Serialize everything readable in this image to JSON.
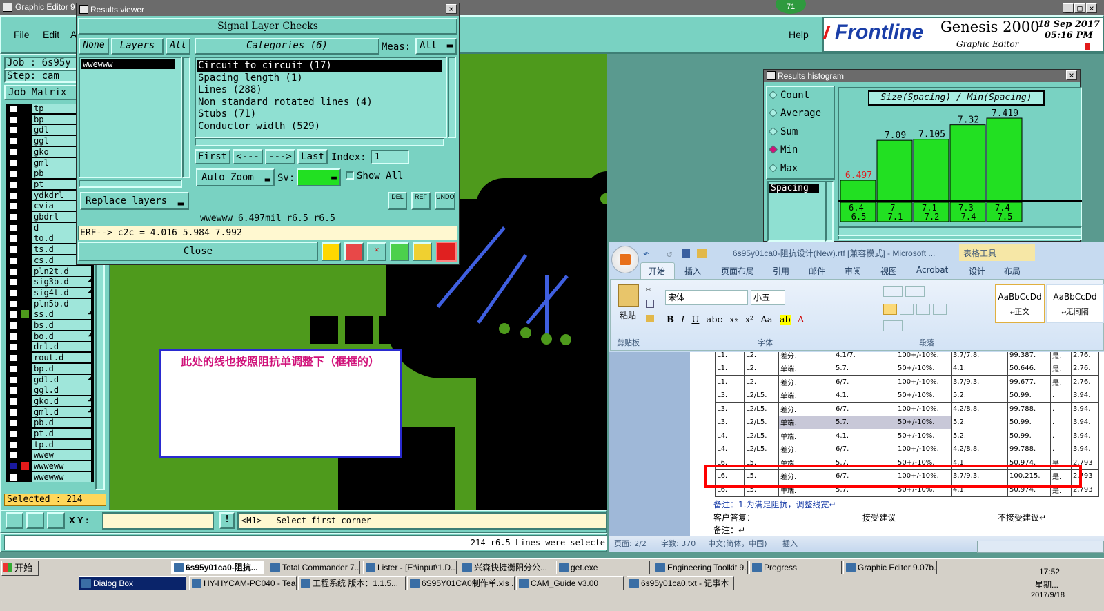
{
  "main_window": {
    "title": "Graphic Editor 9",
    "menu": [
      "File",
      "Edit",
      "A"
    ],
    "help": "Help",
    "brand": "Frontline",
    "product": "Genesis 2000",
    "subtitle": "Graphic Editor",
    "date": "18 Sep 2017",
    "time": "05:16 PM",
    "badge": "71"
  },
  "job": {
    "job_label": "Job : 6s95y",
    "step_label": "Step: cam",
    "job_matrix": "Job Matrix"
  },
  "layers": [
    "tp",
    "bp",
    "gdl",
    "ggl",
    "gko",
    "gml",
    "pb",
    "pt",
    "ydkdrl",
    "cvia",
    "gbdrl",
    "d",
    "to.d",
    "ts.d",
    "cs.d",
    "pln2t.d",
    "sig3b.d",
    "sig4t.d",
    "pln5b.d",
    "ss.d",
    "bs.d",
    "bo.d",
    "drl.d",
    "rout.d",
    "bp.d",
    "gdl.d",
    "ggl.d",
    "gko.d",
    "gml.d",
    "pb.d",
    "pt.d",
    "tp.d",
    "wwew",
    "wwweww",
    "wwewww"
  ],
  "status": {
    "selected": "Selected : 214",
    "xy_label": "X Y :",
    "prompt": "<M1> - Select first corner",
    "bottom_msg": "214 r6.5 Lines were selecte"
  },
  "results_viewer": {
    "title": "Results viewer",
    "header": "Signal Layer Checks",
    "none_btn": "None",
    "layers_btn": "Layers",
    "all_btn": "All",
    "layer_item": "wwewww",
    "categories": "Categories (6)",
    "meas_label": "Meas:",
    "meas_value": "All",
    "items": [
      "Circuit to circuit (17)",
      "Spacing length (1)",
      "Lines (288)",
      "Non standard rotated lines (4)",
      "Stubs (71)",
      "Conductor width (529)"
    ],
    "first": "First",
    "prev": "<---",
    "next": "--->",
    "last": "Last",
    "index_label": "Index:",
    "index_value": "1",
    "auto_zoom": "Auto Zoom",
    "sv_label": "Sv:",
    "show_all": "Show All",
    "replace_layers": "Replace layers",
    "del": "DEL",
    "ref": "REF",
    "undo": "UNDO",
    "info": "wwewww 6.497mil  r6.5  r6.5",
    "erf": "ERF--> c2c = 4.016 5.984 7.992",
    "close": "Close"
  },
  "annotation": {
    "text": "此处的线也按照阻抗单调整下（框框的）"
  },
  "histogram": {
    "title": "Results histogram",
    "options": [
      "Count",
      "Average",
      "Sum",
      "Min",
      "Max"
    ],
    "selected_option": "Min",
    "list_item": "Spacing",
    "chart_title": "Size(Spacing) / Min(Spacing)",
    "chart_data": {
      "type": "bar",
      "title": "Size(Spacing) / Min(Spacing)",
      "categories": [
        "6.4-6.5",
        "7-7.1",
        "7.1-7.2",
        "7.3-7.4",
        "7.4-7.5"
      ],
      "labels": [
        "6.4-\n6.5",
        "7-\n7.1",
        "7.1-\n7.2",
        "7.3-\n7.4",
        "7.4-\n7.5"
      ],
      "value_labels": [
        "6.497",
        "7.09",
        "7.105",
        "7.32",
        "7.419"
      ],
      "values": [
        6.497,
        7.09,
        7.105,
        7.32,
        7.419
      ]
    }
  },
  "word": {
    "title": "6s95y01ca0-阻抗设计(New).rtf [兼容模式] - Microsoft ...",
    "table_tools": "表格工具",
    "tabs": [
      "开始",
      "插入",
      "页面布局",
      "引用",
      "邮件",
      "审阅",
      "视图",
      "Acrobat",
      "设计",
      "布局"
    ],
    "font": "宋体",
    "size": "小五",
    "paste": "粘贴",
    "clipboard": "剪贴板",
    "font_group": "字体",
    "para_group": "段落",
    "style1": "AaBbCcDd",
    "style1_name": "↵正文",
    "style2": "AaBbCcDd",
    "style2_name": "↵无间隔",
    "table": [
      [
        "L1.",
        "L2.",
        "差分.",
        "4.1/7.",
        "100+/-10%.",
        "3.7/7.8.",
        "99.387.",
        "是.",
        "2.76."
      ],
      [
        "L1.",
        "L2.",
        "单端.",
        "5.7.",
        "50+/-10%.",
        "4.1.",
        "50.646.",
        "是.",
        "2.76."
      ],
      [
        "L1.",
        "L2.",
        "差分.",
        "6/7.",
        "100+/-10%.",
        "3.7/9.3.",
        "99.677.",
        "是.",
        "2.76."
      ],
      [
        "L3.",
        "L2/L5.",
        "单端.",
        "4.1.",
        "50+/-10%.",
        "5.2.",
        "50.99.",
        ".",
        "3.94."
      ],
      [
        "L3.",
        "L2/L5.",
        "差分.",
        "6/7.",
        "100+/-10%.",
        "4.2/8.8.",
        "99.788.",
        ".",
        "3.94."
      ],
      [
        "L3.",
        "L2/L5.",
        "单端.",
        "5.7.",
        "50+/-10%.",
        "5.2.",
        "50.99.",
        ".",
        "3.94."
      ],
      [
        "L4.",
        "L2/L5.",
        "单端.",
        "4.1.",
        "50+/-10%.",
        "5.2.",
        "50.99.",
        ".",
        "3.94."
      ],
      [
        "L4.",
        "L2/L5.",
        "差分.",
        "6/7.",
        "100+/-10%.",
        "4.2/8.8.",
        "99.788.",
        ".",
        "3.94."
      ],
      [
        "L6.",
        "L5.",
        "单端.",
        "5.7.",
        "50+/-10%.",
        "4.1.",
        "50.974.",
        "是.",
        "2.793"
      ],
      [
        "L6.",
        "L5.",
        "差分.",
        "6/7.",
        "100+/-10%.",
        "3.7/9.3.",
        "100.215.",
        "是.",
        "2.793"
      ],
      [
        "L6.",
        "L5.",
        "单端.",
        "5.7.",
        "50+/-10%.",
        "4.1.",
        "50.974.",
        "是.",
        "2.793"
      ]
    ],
    "note1": "备注：1.为满足阻抗，调整线宽↵",
    "reply": "客户答复：",
    "accept": "接受建议",
    "reject": "不接受建议↵",
    "note2": "备注：↵",
    "status_page": "页面: 2/2",
    "status_words": "字数: 370",
    "status_lang": "中文(简体，中国)",
    "status_insert": "插入"
  },
  "taskbar": {
    "start": "开始",
    "row1": [
      "6s95y01ca0-阻抗...",
      "Total Commander 7....",
      "Lister - [E:\\input\\1.D...",
      "兴森快捷衡阳分公...",
      "get.exe",
      "Engineering Toolkit 9...",
      "Progress",
      "Graphic Editor 9.07b..."
    ],
    "row2": [
      "Dialog Box",
      "HY-HYCAM-PC040 - Tea...",
      "工程系统  版本：1.1.5...",
      "6S95Y01CA0制作单.xls ...",
      "CAM_Guide v3.00",
      "6s95y01ca0.txt - 记事本"
    ],
    "clock": "17:52",
    "weekday": "星期...",
    "date": "2017/9/18"
  },
  "colors": {
    "panel": "#79d2c2",
    "board": "#4e9a1c",
    "trace": "#3f5fe0",
    "hist_bar": "#22e022",
    "highlight": "#ff0000"
  }
}
